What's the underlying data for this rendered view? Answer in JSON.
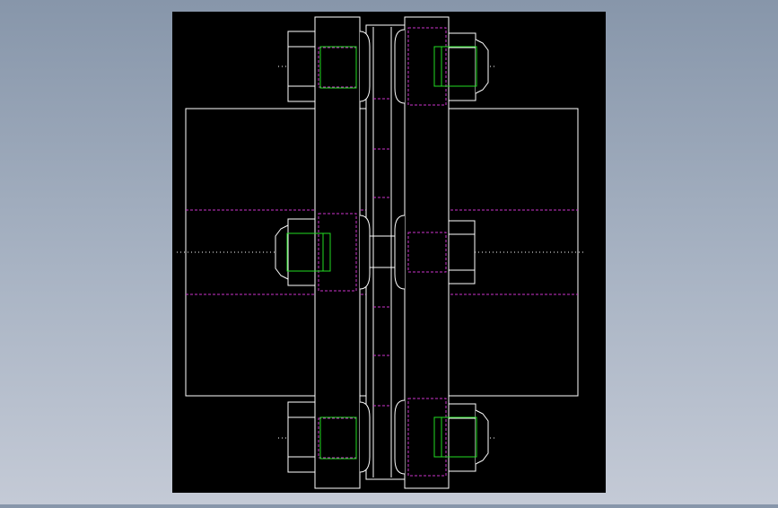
{
  "viewport": {
    "name": "cad-model-viewport",
    "background_color": "#8a99ad",
    "canvas_color": "#000000"
  },
  "drawing": {
    "kind": "coupling-assembly-side-view",
    "colors": {
      "outline": "#ffffff",
      "hidden_line": "#cc33cc",
      "thread": "#22dd22",
      "centerline": "#ffffff"
    },
    "parts": [
      "hub-left",
      "flange-left",
      "spacer-disc",
      "flange-right",
      "bolt-top-left",
      "nut-top-right",
      "nut-middle-left",
      "nut-middle-right",
      "bolt-bottom-left",
      "nut-bottom-right"
    ]
  }
}
